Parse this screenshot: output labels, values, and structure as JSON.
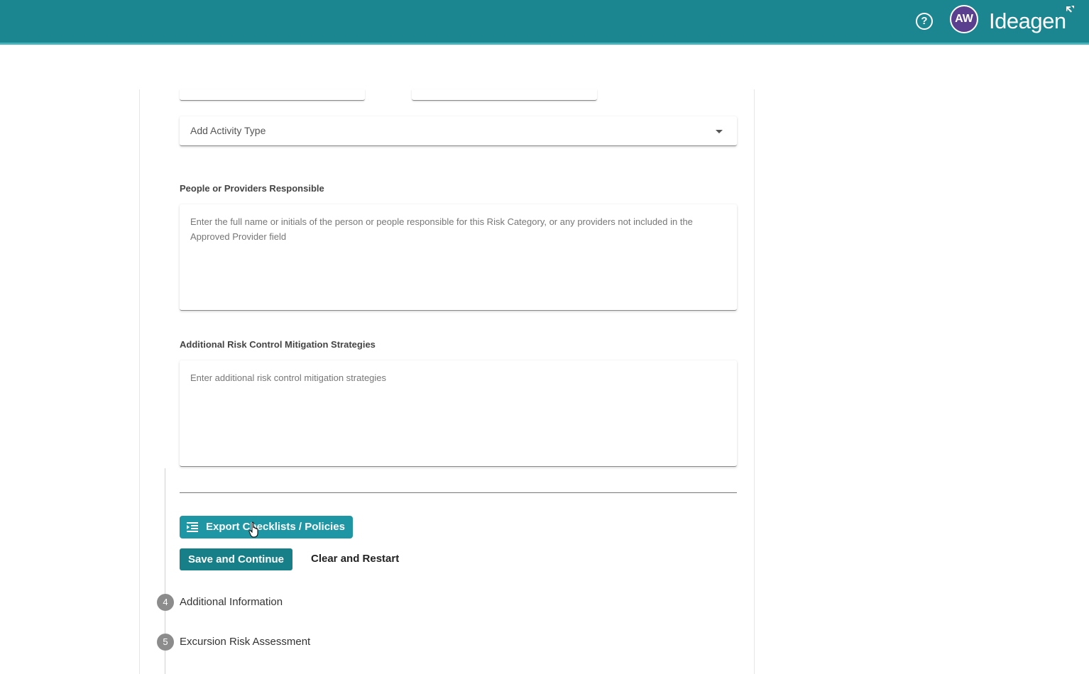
{
  "header": {
    "help_glyph": "?",
    "avatar_initials": "AW",
    "logo_text": "Ideagen",
    "bar_color": "#1b8590"
  },
  "form": {
    "activity_type_select": {
      "placeholder": "Add Activity Type"
    },
    "people_responsible": {
      "label": "People or Providers Responsible",
      "placeholder": "Enter the full name or initials of the person or people responsible for this Risk Category, or any providers not included in the Approved Provider field",
      "value": ""
    },
    "mitigation": {
      "label": "Additional Risk Control Mitigation Strategies",
      "placeholder": "Enter additional risk control mitigation strategies",
      "value": ""
    }
  },
  "actions": {
    "export_label": "Export Checklists / Policies",
    "save_label": "Save and Continue",
    "clear_label": "Clear and Restart"
  },
  "steps": [
    {
      "number": "4",
      "label": "Additional Information"
    },
    {
      "number": "5",
      "label": "Excursion Risk Assessment"
    }
  ],
  "colors": {
    "primary": "#177f88",
    "export_button": "#1e96a3",
    "avatar": "#5a3f8e"
  }
}
